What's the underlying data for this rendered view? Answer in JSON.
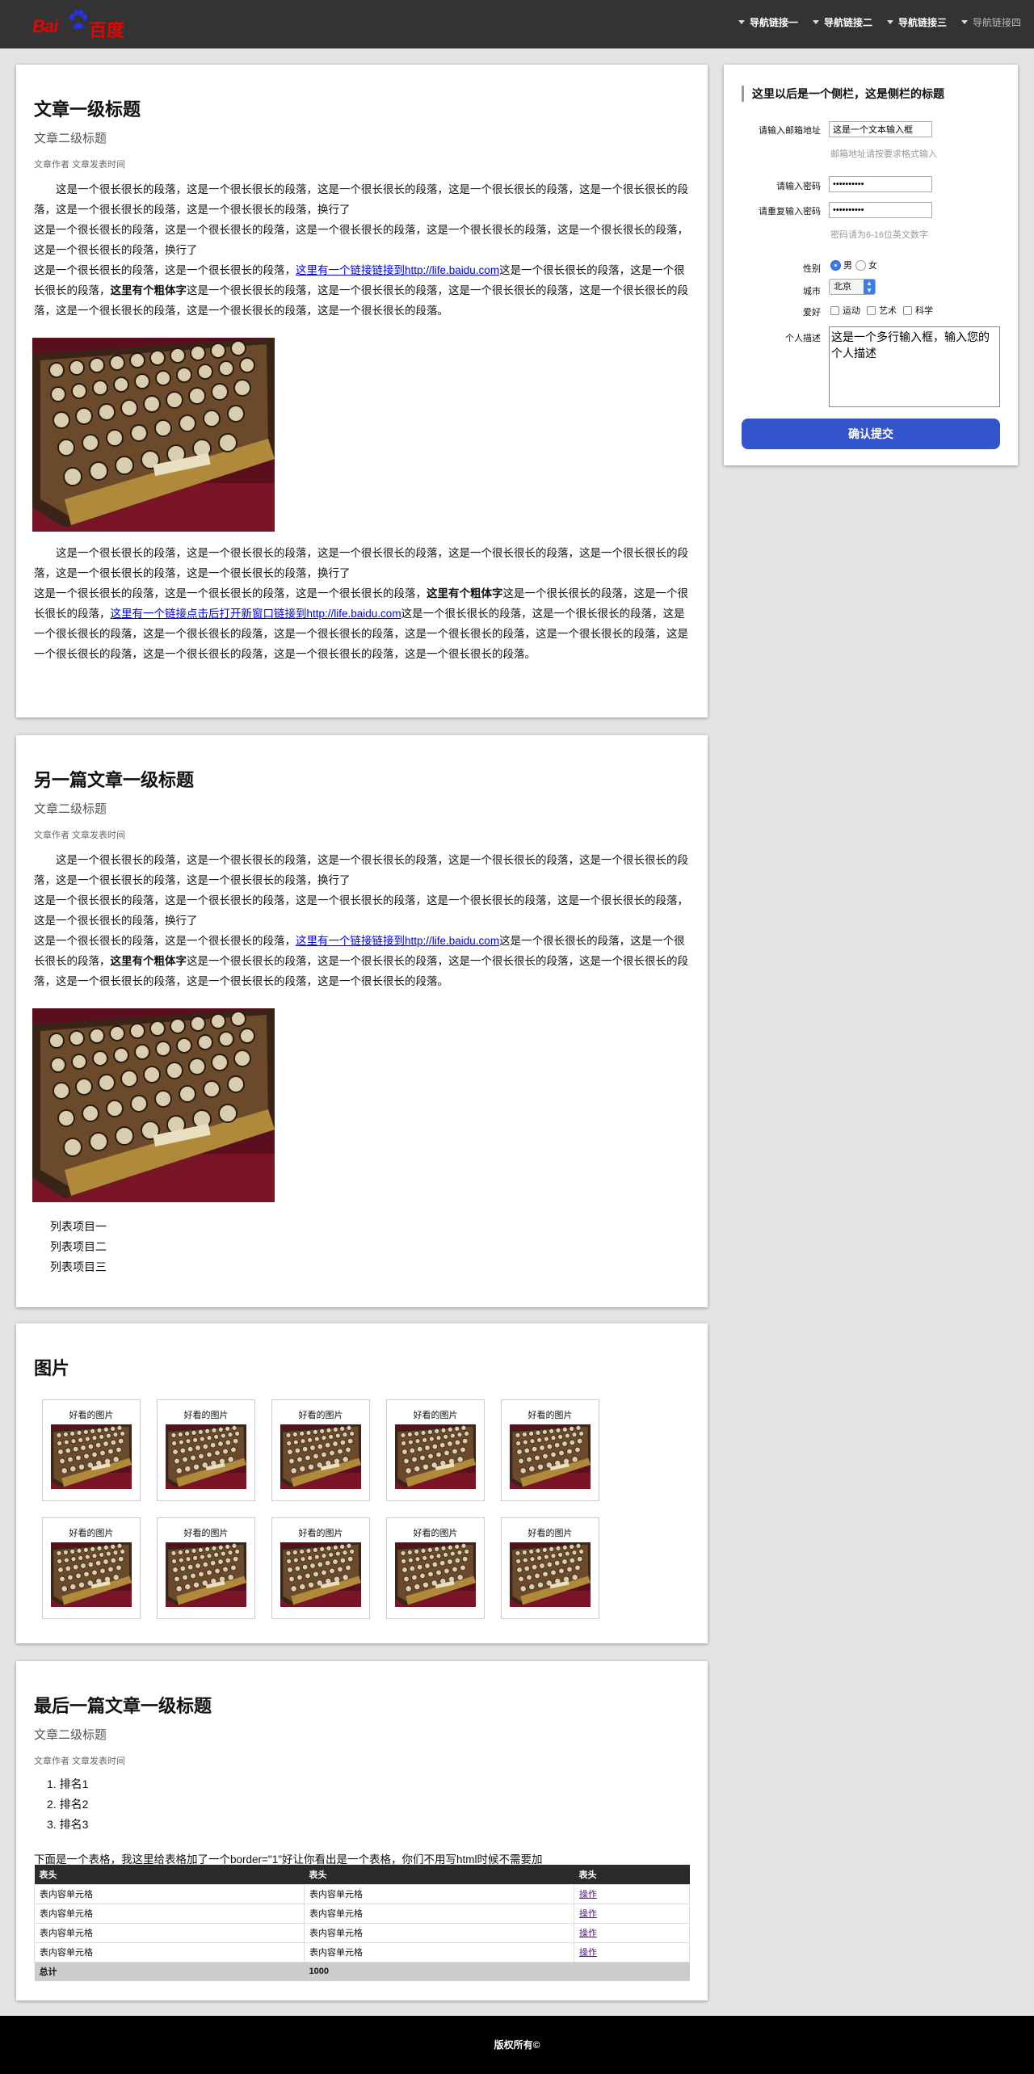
{
  "header": {
    "logo_left": "Bai",
    "logo_right": "百度",
    "nav": [
      {
        "label": "导航链接一"
      },
      {
        "label": "导航链接二"
      },
      {
        "label": "导航链接三"
      },
      {
        "label": "导航链接四"
      }
    ]
  },
  "article1": {
    "title": "文章一级标题",
    "subtitle": "文章二级标题",
    "meta": "文章作者 文章发表时间",
    "p1": "这是一个很长很长的段落，这是一个很长很长的段落，这是一个很长很长的段落，这是一个很长很长的段落，这是一个很长很长的段落，这是一个很长很长的段落，这是一个很长很长的段落，换行了",
    "p2": "这是一个很长很长的段落，这是一个很长很长的段落，这是一个很长很长的段落，这是一个很长很长的段落，这是一个很长很长的段落，这是一个很长很长的段落，换行了",
    "p3_a": "这是一个很长很长的段落，这是一个很长很长的段落，",
    "p3_link": "这里有一个链接链接到http://life.baidu.com",
    "p3_b": "这是一个很长很长的段落，这是一个很长很长的段落，",
    "p3_bold": "这里有个粗体字",
    "p3_c": "这是一个很长很长的段落，这是一个很长很长的段落，这是一个很长很长的段落，这是一个很长很长的段落，这是一个很长很长的段落，这是一个很长很长的段落，这是一个很长很长的段落。",
    "q1": "这是一个很长很长的段落，这是一个很长很长的段落，这是一个很长很长的段落，这是一个很长很长的段落，这是一个很长很长的段落，这是一个很长很长的段落，这是一个很长很长的段落，换行了",
    "q2_a": "这是一个很长很长的段落，这是一个很长很长的段落，这是一个很长很长的段落，",
    "q2_bold": "这里有个粗体字",
    "q2_b": "这是一个很长很长的段落，这是一个很长很长的段落，",
    "q2_link": "这里有一个链接点击后打开新窗口链接到http://life.baidu.com",
    "q2_c": "这是一个很长很长的段落，这是一个很长很长的段落，这是一个很长很长的段落，这是一个很长很长的段落，这是一个很长很长的段落，这是一个很长很长的段落，这是一个很长很长的段落，这是一个很长很长的段落，这是一个很长很长的段落，这是一个很长很长的段落，这是一个很长很长的段落。"
  },
  "article2": {
    "title": "另一篇文章一级标题",
    "subtitle": "文章二级标题",
    "meta": "文章作者 文章发表时间",
    "p1": "这是一个很长很长的段落，这是一个很长很长的段落，这是一个很长很长的段落，这是一个很长很长的段落，这是一个很长很长的段落，这是一个很长很长的段落，这是一个很长很长的段落，换行了",
    "p2": "这是一个很长很长的段落，这是一个很长很长的段落，这是一个很长很长的段落，这是一个很长很长的段落，这是一个很长很长的段落，这是一个很长很长的段落，换行了",
    "p3_a": "这是一个很长很长的段落，这是一个很长很长的段落，",
    "p3_link": "这里有一个链接链接到http://life.baidu.com",
    "p3_b": "这是一个很长很长的段落，这是一个很长很长的段落，",
    "p3_bold": "这里有个粗体字",
    "p3_c": "这是一个很长很长的段落，这是一个很长很长的段落，这是一个很长很长的段落，这是一个很长很长的段落，这是一个很长很长的段落，这是一个很长很长的段落，这是一个很长很长的段落。",
    "list": [
      "列表项目一",
      "列表项目二",
      "列表项目三"
    ]
  },
  "gallery": {
    "title": "图片",
    "caption": "好看的图片"
  },
  "article3": {
    "title": "最后一篇文章一级标题",
    "subtitle": "文章二级标题",
    "meta": "文章作者 文章发表时间",
    "ranks": [
      "排名1",
      "排名2",
      "排名3"
    ],
    "table_intro": "下面是一个表格，我这里给表格加了一个border=\"1\"好让你看出是一个表格，你们不用写html时候不需要加",
    "table": {
      "headers": [
        "表头",
        "表头",
        "表头"
      ],
      "cell": "表内容单元格",
      "action": "操作",
      "total_label": "总计",
      "total_value": "1000"
    }
  },
  "sidebar": {
    "title": "这里以后是一个侧栏，这是侧栏的标题",
    "email_label": "请输入邮箱地址",
    "email_value": "这是一个文本输入框",
    "email_hint": "邮箱地址请按要求格式输入",
    "pwd_label": "请输入密码",
    "pwd_value": "••••••••••",
    "pwd2_label": "请重复输入密码",
    "pwd2_value": "••••••••••",
    "pwd_hint": "密码请为6-16位英文数字",
    "gender_label": "性别",
    "gender_male": "男",
    "gender_female": "女",
    "city_label": "城市",
    "city_value": "北京",
    "hobby_label": "爱好",
    "hobbies": [
      "运动",
      "艺术",
      "科学"
    ],
    "desc_label": "个人描述",
    "desc_value": "这是一个多行输入框，输入您的个人描述",
    "submit": "确认提交",
    "accent": "#3355cc"
  },
  "footer": {
    "text": "版权所有©"
  }
}
